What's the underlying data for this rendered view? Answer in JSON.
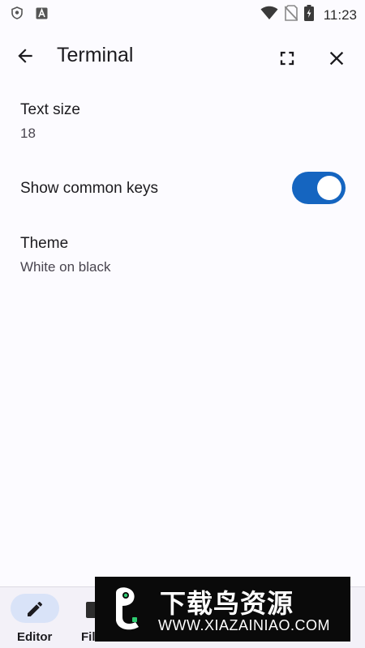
{
  "status_bar": {
    "time": "11:23",
    "left_icons": [
      "shield-icon",
      "a-badge-icon"
    ],
    "right_icons": [
      "wifi-icon",
      "no-sim-icon",
      "battery-charging-icon"
    ]
  },
  "app_bar": {
    "title": "Terminal",
    "back_icon": "arrow-left-icon",
    "fullscreen_icon": "fullscreen-icon",
    "close_icon": "close-icon"
  },
  "settings": {
    "text_size": {
      "title": "Text size",
      "value": "18"
    },
    "common_keys": {
      "title": "Show common keys",
      "enabled": true
    },
    "theme": {
      "title": "Theme",
      "value": "White on black"
    }
  },
  "bottom_nav": {
    "items": [
      {
        "label": "Editor",
        "icon": "pencil-icon",
        "selected": true
      },
      {
        "label": "Fil",
        "icon": "files-icon",
        "selected": false
      }
    ]
  },
  "watermark": {
    "cn_text": "下载鸟资源",
    "url": "WWW.XIAZAINIAO.COM"
  },
  "colors": {
    "background": "#fcfbff",
    "switch_on": "#1565c0",
    "nav_pill": "#d9e3f8",
    "watermark_bg": "#0a0a0a"
  }
}
